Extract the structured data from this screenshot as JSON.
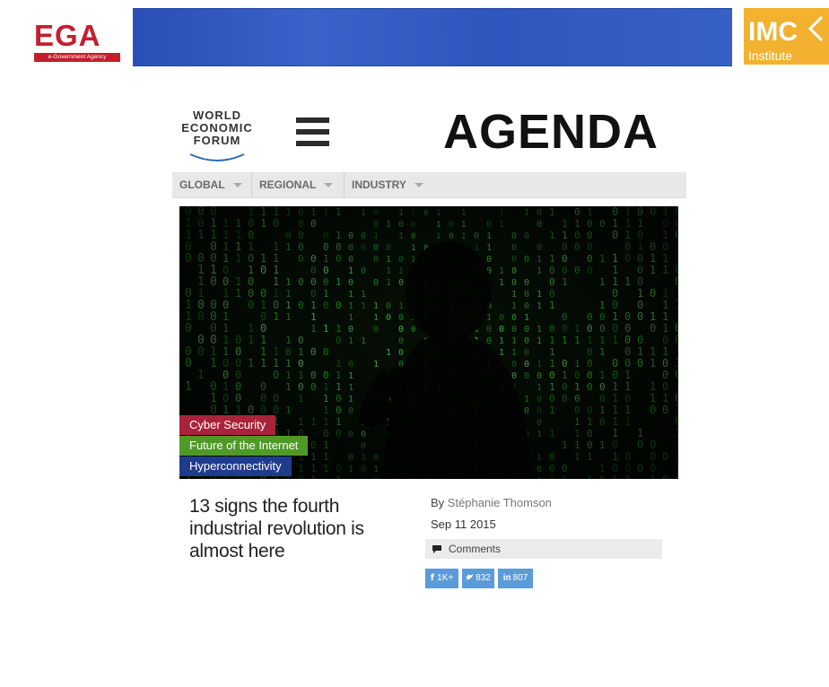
{
  "banner": {
    "left_logo": {
      "name": "EGA",
      "subtitle": "e-Government Agency",
      "color": "#c41e2e"
    },
    "bar_color": "#2f56bd",
    "right_logo": {
      "name": "IMC",
      "subtitle": "Institute",
      "color": "#f2b12e"
    }
  },
  "site": {
    "logo_lines": [
      "WORLD",
      "ECONOMIC",
      "FORUM"
    ],
    "menu_icon": "hamburger-icon",
    "title": "AGENDA"
  },
  "nav": {
    "items": [
      {
        "label": "GLOBAL"
      },
      {
        "label": "REGIONAL"
      },
      {
        "label": "INDUSTRY"
      }
    ]
  },
  "hero": {
    "image": "silhouette of a person in front of green binary code",
    "tags": [
      {
        "label": "Cyber Security",
        "color": "#a9243a"
      },
      {
        "label": "Future of the Internet",
        "color": "#4f9a26"
      },
      {
        "label": "Hyperconnectivity",
        "color": "#1f3c8c"
      }
    ]
  },
  "article": {
    "title": "13 signs the fourth industrial revolution is almost here",
    "by_prefix": "By",
    "author": "Stéphanie Thomson",
    "date": "Sep 11 2015",
    "comments_label": "Comments"
  },
  "share": {
    "facebook": {
      "icon": "facebook-icon",
      "count": "1K+"
    },
    "twitter": {
      "icon": "twitter-icon",
      "count": "832"
    },
    "linkedin": {
      "icon": "linkedin-icon",
      "count": "807"
    }
  }
}
